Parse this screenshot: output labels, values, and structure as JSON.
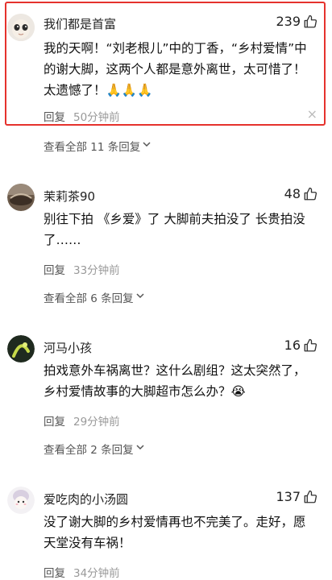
{
  "comments": [
    {
      "username": "我们都是首富",
      "likes": "239",
      "content": "我的天啊！“刘老根儿”中的丁香，“乡村爱情”中的谢大脚，这两个人都是意外离世，太可惜了！太遗憾了！🙏🙏🙏",
      "reply_label": "回复",
      "time": "50分钟前",
      "close": "×",
      "view_all": "查看全部 11 条回复"
    },
    {
      "username": "茉莉茶90",
      "likes": "48",
      "content": "别往下拍 《乡爱》了 大脚前夫拍没了 长贵拍没了……",
      "reply_label": "回复",
      "time": "33分钟前",
      "view_all": "查看全部 6 条回复"
    },
    {
      "username": "河马小孩",
      "likes": "16",
      "content": "拍戏意外车祸离世？这什么剧组？这太突然了，乡村爱情故事的大脚超市怎么办？😭",
      "reply_label": "回复",
      "time": "29分钟前",
      "view_all": "查看全部 2 条回复"
    },
    {
      "username": "爱吃肉的小汤圆",
      "likes": "137",
      "content": "没了谢大脚的乡村爱情再也不完美了。走好，愿天堂没有车祸！",
      "reply_label": "回复",
      "time": "34分钟前"
    }
  ],
  "chevron": "⌄"
}
